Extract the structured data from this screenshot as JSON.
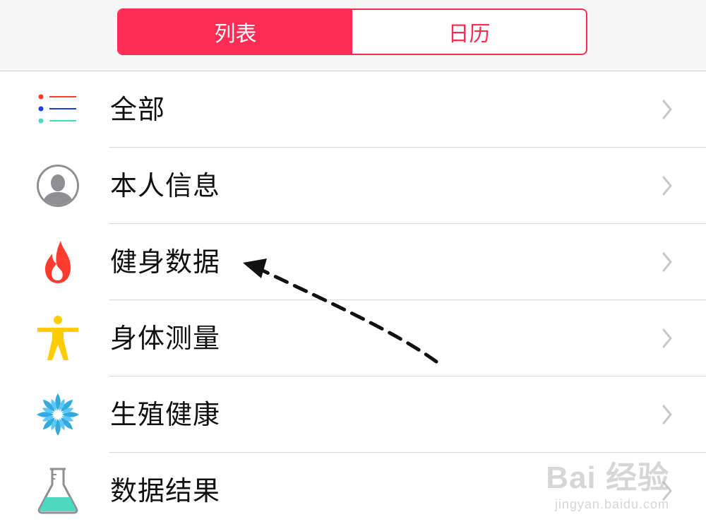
{
  "segmented": {
    "tabs": [
      {
        "label": "列表",
        "active": true
      },
      {
        "label": "日历",
        "active": false
      }
    ]
  },
  "list": {
    "items": [
      {
        "label": "全部",
        "icon": "list-icon"
      },
      {
        "label": "本人信息",
        "icon": "person-icon"
      },
      {
        "label": "健身数据",
        "icon": "flame-icon"
      },
      {
        "label": "身体测量",
        "icon": "body-figure-icon"
      },
      {
        "label": "生殖健康",
        "icon": "flower-icon"
      },
      {
        "label": "数据结果",
        "icon": "flask-icon"
      }
    ]
  },
  "watermark": {
    "text": "Bai 经验",
    "url": "jingyan.baidu.com"
  },
  "colors": {
    "accent": "#ff2d55",
    "chevron": "#c7c7cc",
    "flame": "#ff3b30",
    "figure": "#ffcc00",
    "flower": "#34aadc",
    "flask": "#4cd9c0"
  }
}
